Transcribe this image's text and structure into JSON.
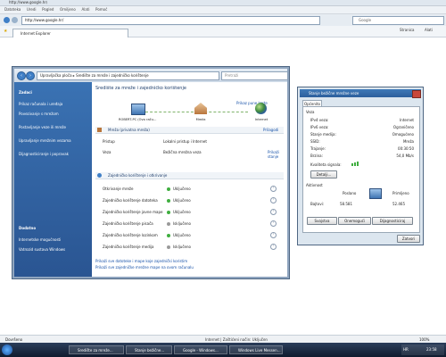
{
  "browser": {
    "url": "http://www.google.hr/",
    "menu": [
      "Datoteka",
      "Uredi",
      "Pogled",
      "Omiljeno",
      "Alati",
      "Pomoć"
    ],
    "search_placeholder": "Google",
    "tab_label": "Internet Explorer",
    "toolbar": [
      "Stranica",
      "Alati"
    ]
  },
  "net_window": {
    "breadcrumb": "Upravljačka ploča ▸ Središte za mreže i zajedničko korištenje",
    "search_placeholder": "Pretraži",
    "sidebar_tasks": [
      "Zadaci",
      "Prikaz računala i uređaja",
      "Povezivanje s mrežom",
      "Postavljanje veze ili mreže",
      "Upravljanje mrežnim vezama",
      "Dijagnosticiranje i popravak"
    ],
    "sidebar_see_also": [
      "Dodatno",
      "Internetske mogućnosti",
      "Vatrozid sustava Windows"
    ],
    "title": "Središte za mreže i zajedničko korištenje",
    "full_map_link": "Prikaz pune karte",
    "map_nodes": [
      "ROBERT-PC (Ovo računalo)",
      "Mreža",
      "Internet"
    ],
    "network_name": "Mreža (privatna mreža)",
    "customize_link": "Prilagodi",
    "rows": [
      {
        "label": "Pristup",
        "value": "Lokalni pristup i Internet"
      },
      {
        "label": "Veza",
        "value": "Bežična mrežna veza"
      },
      {
        "label": "",
        "value": "Prikaži stanje"
      }
    ],
    "sharing_title": "Zajedničko korištenje i otkrivanje",
    "sharing": [
      {
        "label": "Otkrivanje mreže",
        "value": "Uključeno"
      },
      {
        "label": "Zajedničko korištenje datoteka",
        "value": "Uključeno"
      },
      {
        "label": "Zajedničko korištenje javne mape",
        "value": "Uključeno"
      },
      {
        "label": "Zajedničko korištenje pisača",
        "value": "Isključeno"
      },
      {
        "label": "Zajedničko korištenje lozinkom",
        "value": "Uključeno"
      },
      {
        "label": "Zajedničko korištenje medija",
        "value": "Isključeno"
      }
    ],
    "bottom_links": [
      "Prikaži sve datoteke i mape koje zajednički koristim",
      "Prikaži sve zajedničke mrežne mape na ovom računalu"
    ]
  },
  "status_dialog": {
    "title": "Stanje bežične mrežne veze",
    "tab": "Općenito",
    "group_connection": "Veza",
    "fields": [
      {
        "label": "IPv4 veza:",
        "value": "Internet"
      },
      {
        "label": "IPv6 veza:",
        "value": "Ograničeno"
      },
      {
        "label": "Stanje medija:",
        "value": "Omogućeno"
      },
      {
        "label": "SSID:",
        "value": "Mreža"
      },
      {
        "label": "Trajanje:",
        "value": "00:30:50"
      },
      {
        "label": "Brzina:",
        "value": "54,0 Mb/s"
      }
    ],
    "signal_label": "Kvaliteta signala:",
    "details_button": "Detalji...",
    "group_activity": "Aktivnost",
    "sent_label": "Poslano",
    "received_label": "Primljeno",
    "bytes_label": "Bajtovi:",
    "sent_value": "58.581",
    "received_value": "52.465",
    "buttons": [
      "Svojstva",
      "Onemogući",
      "Dijagnosticiraj"
    ],
    "close_button": "Zatvori"
  },
  "status_bar": {
    "text": "Dovršeno",
    "zone": "Internet | Zaštićeni način: Uključen",
    "zoom": "100%"
  },
  "taskbar": {
    "tasks": [
      "Središte za mreže...",
      "Stanje bežične...",
      "Google - Windows...",
      "Windows Live Messenger"
    ],
    "language": "HR",
    "clock": "23:58"
  }
}
